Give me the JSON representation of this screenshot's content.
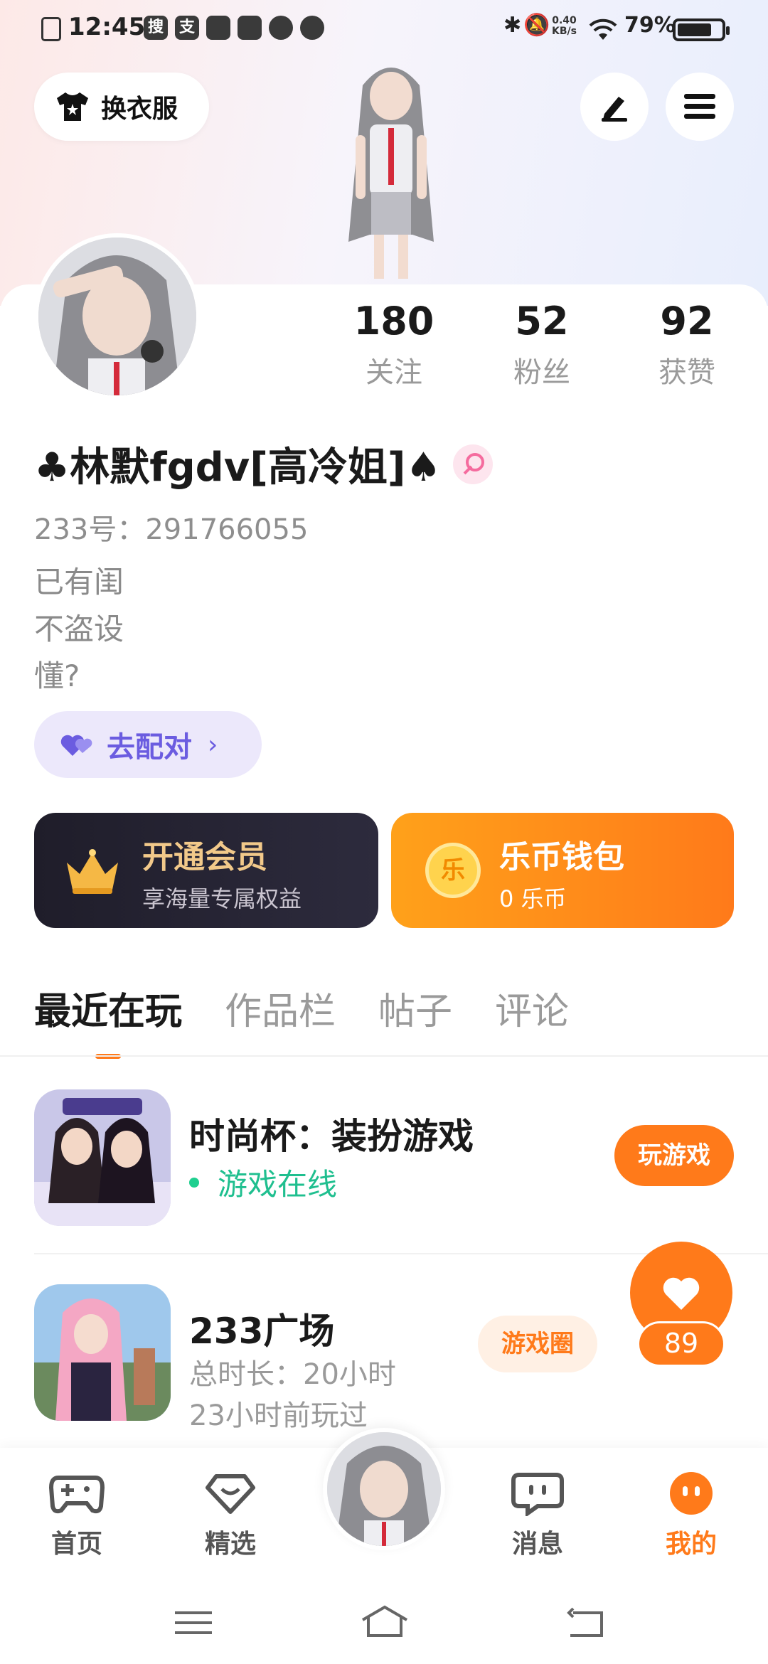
{
  "status_bar": {
    "time": "12:45",
    "app_icons": [
      "搜",
      "支"
    ],
    "net_speed_value": "0.40",
    "net_speed_unit": "KB/s",
    "battery_text": "79%",
    "battery_level": 0.79
  },
  "header": {
    "dress_up_label": "换衣服",
    "edit_icon": "pencil-icon",
    "menu_icon": "hamburger-menu-icon"
  },
  "profile": {
    "stats": [
      {
        "value": "180",
        "label": "关注"
      },
      {
        "value": "52",
        "label": "粉丝"
      },
      {
        "value": "92",
        "label": "获赞"
      }
    ],
    "nickname": "♣林默fgdv[高冷姐]♠",
    "gender": "female",
    "uid": "233号：291766055",
    "bio_lines": [
      "已有闺",
      "不盗设",
      "懂?"
    ],
    "pair_button": "去配对"
  },
  "cards": {
    "vip_title": "开通会员",
    "vip_sub": "享海量专属权益",
    "wallet_title": "乐币钱包",
    "wallet_sub": "0 乐币",
    "coin_glyph": "乐"
  },
  "tabs": [
    "最近在玩",
    "作品栏",
    "帖子",
    "评论"
  ],
  "games": [
    {
      "name": "时尚杯：装扮游戏",
      "status": "游戏在线",
      "action": "玩游戏"
    },
    {
      "name": "233广场",
      "duration": "总时长：20小时",
      "last_played": "23小时前玩过",
      "circle_label": "游戏圈"
    }
  ],
  "like_float": {
    "count": "89"
  },
  "bottom_nav": [
    {
      "label": "首页",
      "icon": "gamepad-icon"
    },
    {
      "label": "精选",
      "icon": "heart-diamond-icon"
    },
    {
      "label": "消息",
      "icon": "chat-bubble-icon"
    },
    {
      "label": "我的",
      "icon": "smile-face-icon"
    }
  ],
  "colors": {
    "accent": "#ff7a1a",
    "online_green": "#1fbf8f",
    "pair_purple": "#6b5ce0",
    "vip_gold": "#f2c98a"
  }
}
